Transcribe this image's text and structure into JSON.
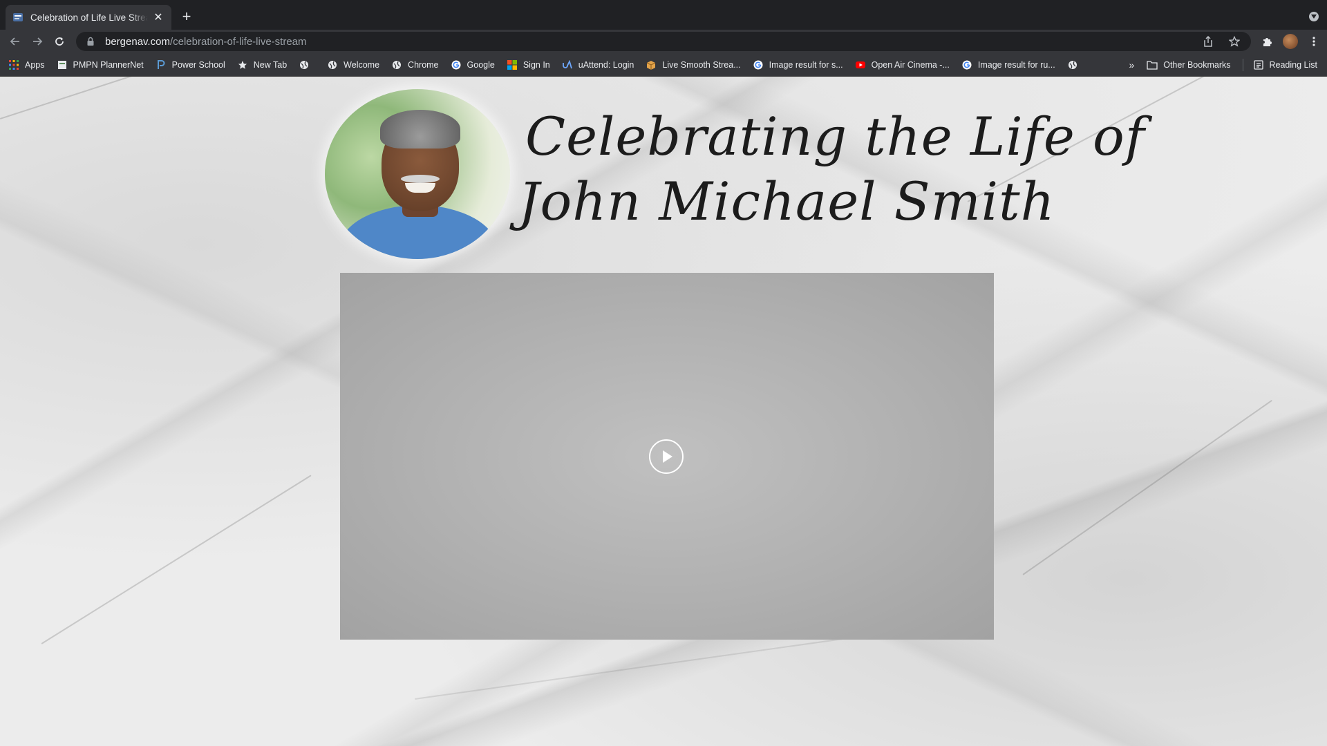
{
  "tab": {
    "title": "Celebration of Life Live Stream"
  },
  "omnibox": {
    "host": "bergenav.com",
    "path": "/celebration-of-life-live-stream"
  },
  "bookmarks": [
    {
      "label": "Apps",
      "icon": "apps-grid-icon"
    },
    {
      "label": "PMPN PlannerNet",
      "icon": "page-icon"
    },
    {
      "label": "Power School",
      "icon": "powerschool-icon"
    },
    {
      "label": "New Tab",
      "icon": "star-icon"
    },
    {
      "label": "",
      "icon": "globe-icon"
    },
    {
      "label": "Welcome",
      "icon": "globe-icon"
    },
    {
      "label": "Chrome",
      "icon": "globe-icon"
    },
    {
      "label": "Google",
      "icon": "google-icon"
    },
    {
      "label": "Sign In",
      "icon": "microsoft-icon"
    },
    {
      "label": "uAttend: Login",
      "icon": "uattend-icon"
    },
    {
      "label": "Live Smooth Strea...",
      "icon": "box-icon"
    },
    {
      "label": "Image result for s...",
      "icon": "google-icon"
    },
    {
      "label": "Open Air Cinema -...",
      "icon": "youtube-icon"
    },
    {
      "label": "Image result for ru...",
      "icon": "google-icon"
    },
    {
      "label": "",
      "icon": "globe-icon"
    }
  ],
  "bookmarks_right": {
    "more": "»",
    "other": "Other Bookmarks",
    "reading": "Reading List"
  },
  "page": {
    "headline_line1": "Celebrating the Life of",
    "headline_line2": "John Michael Smith"
  },
  "colors": {
    "chrome_dark": "#202124",
    "chrome": "#35363a",
    "text": "#e8eaed",
    "player": "#b0b0b0"
  }
}
